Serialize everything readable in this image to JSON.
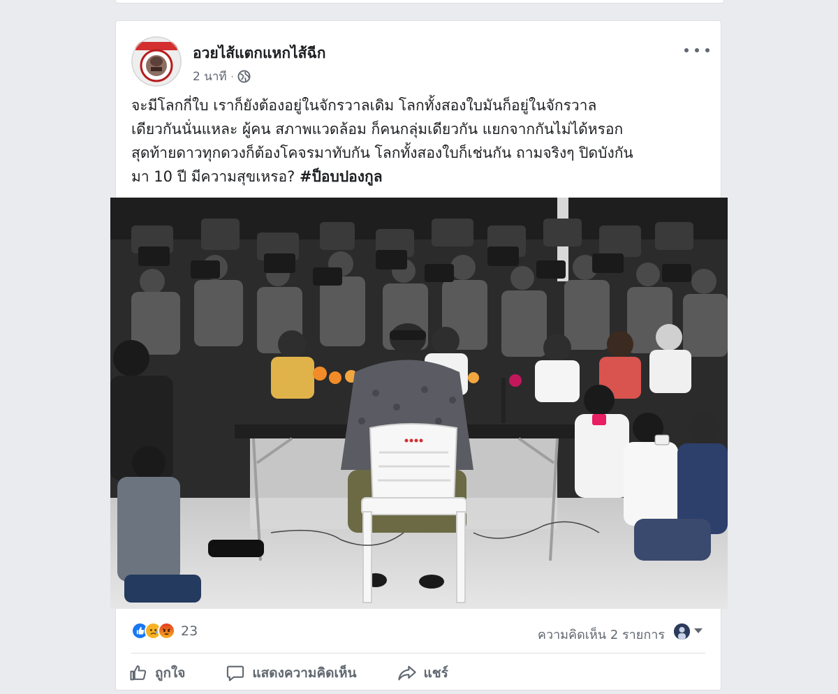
{
  "post": {
    "author": "อวยไส้แตกแหกไส้ฉีก",
    "time": "2 นาที",
    "meta_separator": "·",
    "privacy_icon": "globe-icon",
    "more_icon": "more-options-icon",
    "text_lines": [
      "จะมีโลกกี่ใบ เราก็ยังต้องอยู่ในจักรวาลเดิม โลกทั้งสองใบมันก็อยู่ในจักรวาล",
      "เดียวกันนั่นแหละ ผู้คน สภาพแวดล้อม ก็คนกลุ่มเดียวกัน แยกจากกันไม่ได้หรอก",
      "สุดท้ายดาวทุกดวงก็ต้องโคจรมาทับกัน โลกทั้งสองใบก็เช่นกัน ถามจริงๆ ปิดบังกัน"
    ],
    "text_last_line": "มา 10 ปี มีความสุขเหรอ?",
    "hashtag": "#ป็อบปองกูล",
    "photo_chair_brand": "SAHAHODDE"
  },
  "reactions": {
    "icons": [
      "like-reaction-icon",
      "sad-reaction-icon",
      "angry-reaction-icon"
    ],
    "count": "23",
    "comments_label": "ความคิดเห็น 2 รายการ"
  },
  "actions": {
    "like_label": "ถูกใจ",
    "comment_label": "แสดงความคิดเห็น",
    "share_label": "แชร์"
  },
  "colors": {
    "page_background": "#e9ebee",
    "card_background": "#ffffff",
    "secondary_text": "#606770",
    "like_blue": "#1877f2",
    "sad_yellow": "#f7b125",
    "angry_orange": "#e9710f"
  }
}
